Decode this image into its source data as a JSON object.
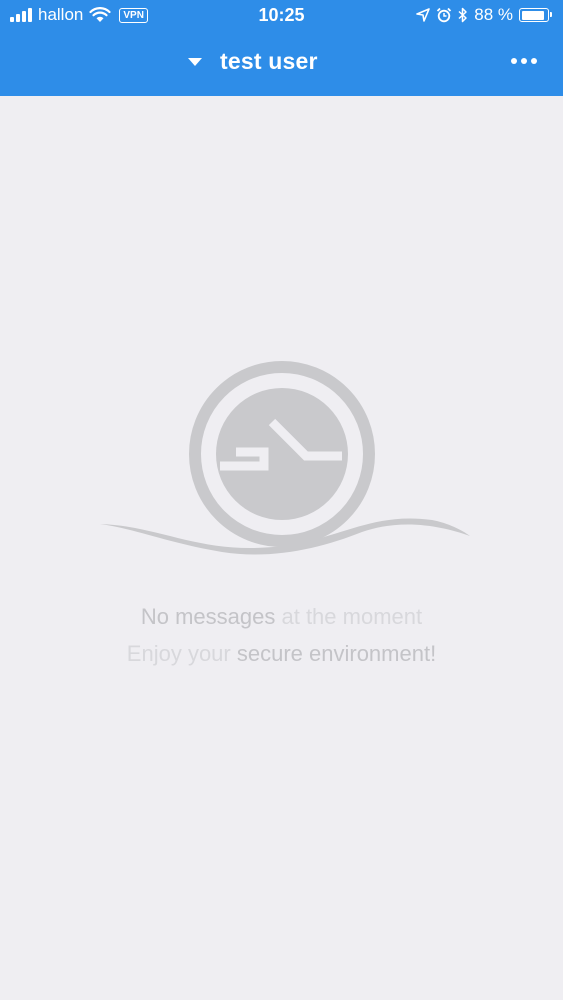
{
  "status_bar": {
    "carrier": "hallon",
    "vpn_label": "VPN",
    "time": "10:25",
    "battery_text": "88 %",
    "battery_level": 0.88,
    "icons": [
      "signal-icon",
      "wifi-icon",
      "location-arrow-icon",
      "alarm-icon",
      "bluetooth-icon",
      "battery-icon"
    ]
  },
  "header": {
    "title": "test user",
    "dropdown_icon": "caret-down-icon",
    "menu_icon": "more-horizontal-icon",
    "background_color": "#2e8de8"
  },
  "empty_state": {
    "line1": {
      "part1": "No messages",
      "part2": " at the moment"
    },
    "line2": {
      "part1": "Enjoy your ",
      "part2": "secure environment!"
    },
    "logo_icon": "app-logo-icon",
    "logo_color": "#c9c9cc"
  }
}
